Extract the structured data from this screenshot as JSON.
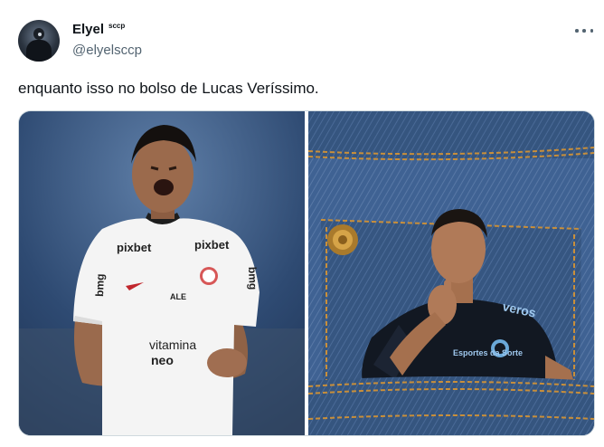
{
  "author": {
    "display_name": "Elyel",
    "badge": "sccp",
    "handle": "@elyelsccp"
  },
  "tweet": {
    "text": "enquanto isso no bolso de Lucas Veríssimo."
  },
  "media": {
    "left_photo": {
      "shirt_sponsors": [
        "pixbet",
        "pixbet",
        "bmg",
        "bmg",
        "vitamina",
        "neo",
        "ALE"
      ]
    },
    "right_photo": {
      "shirt_sponsors": [
        "Esportes da Sorte",
        "veros"
      ]
    }
  },
  "colors": {
    "text": "#0f1419",
    "secondary": "#536471",
    "border": "#cfd9de",
    "denim": "#3d5f8f"
  },
  "icons": {
    "more": "more-horizontal-icon"
  }
}
